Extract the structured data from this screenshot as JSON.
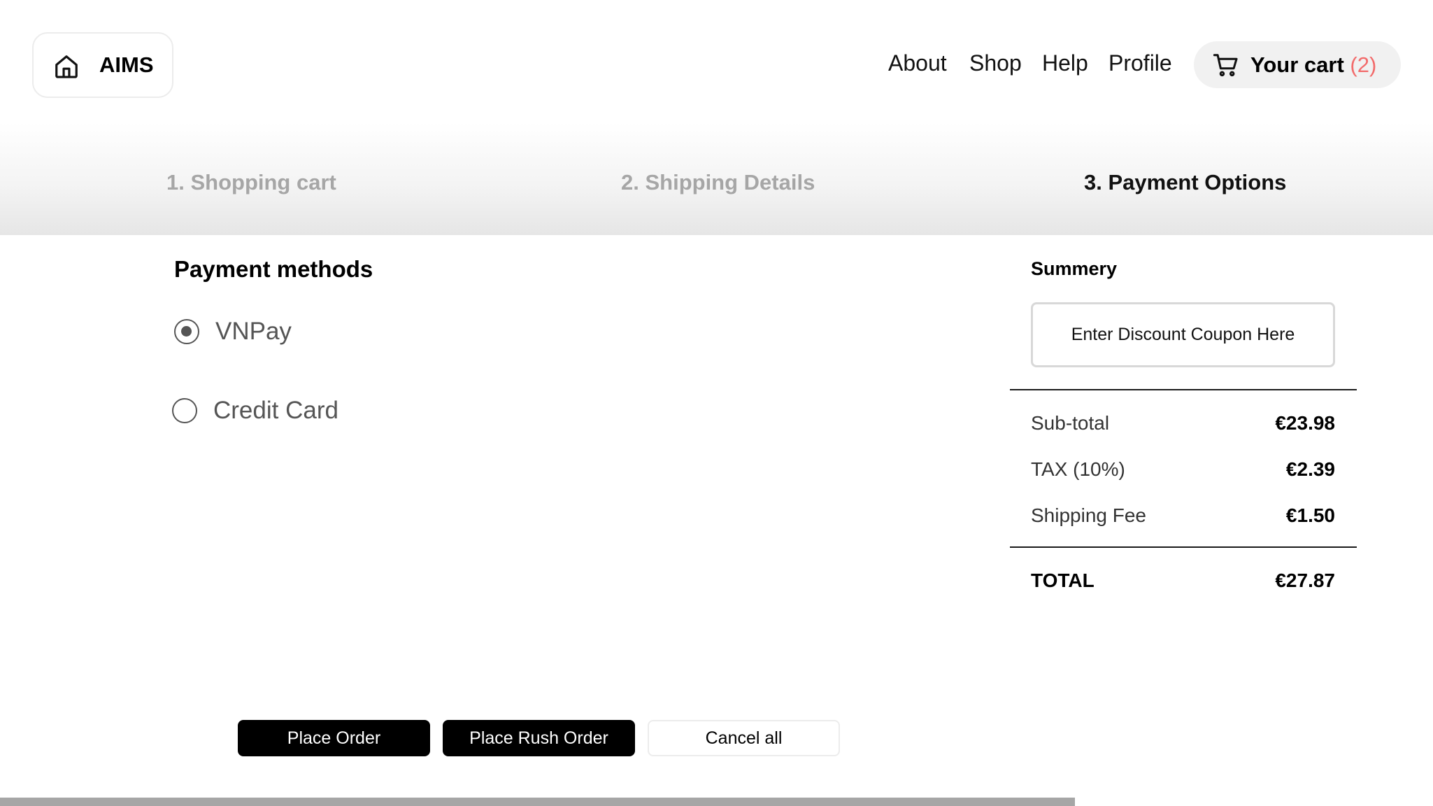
{
  "header": {
    "brand": "AIMS",
    "home_icon": "home-icon",
    "nav": [
      "About",
      "Shop",
      "Help",
      "Profile"
    ],
    "cart": {
      "label": "Your cart",
      "count": "(2)",
      "icon": "cart-icon"
    }
  },
  "steps": [
    {
      "label": "1. Shopping cart",
      "active": false
    },
    {
      "label": "2. Shipping Details",
      "active": false
    },
    {
      "label": "3. Payment Options",
      "active": true
    }
  ],
  "payment": {
    "title": "Payment methods",
    "options": [
      {
        "label": "VNPay",
        "selected": true
      },
      {
        "label": "Credit Card",
        "selected": false
      }
    ]
  },
  "summary": {
    "title": "Summery",
    "coupon_label": "Enter Discount Coupon Here",
    "rows": [
      {
        "label": "Sub-total",
        "value": "€23.98"
      },
      {
        "label": "TAX (10%)",
        "value": "€2.39"
      },
      {
        "label": "Shipping Fee",
        "value": "€1.50"
      }
    ],
    "total": {
      "label": "TOTAL",
      "value": "€27.87"
    }
  },
  "actions": {
    "place_order": "Place Order",
    "place_rush_order": "Place Rush Order",
    "cancel_all": "Cancel all"
  },
  "colors": {
    "accent_count": "#f26b6b",
    "inactive_step": "#a6a6a6",
    "button_dark": "#000000"
  }
}
